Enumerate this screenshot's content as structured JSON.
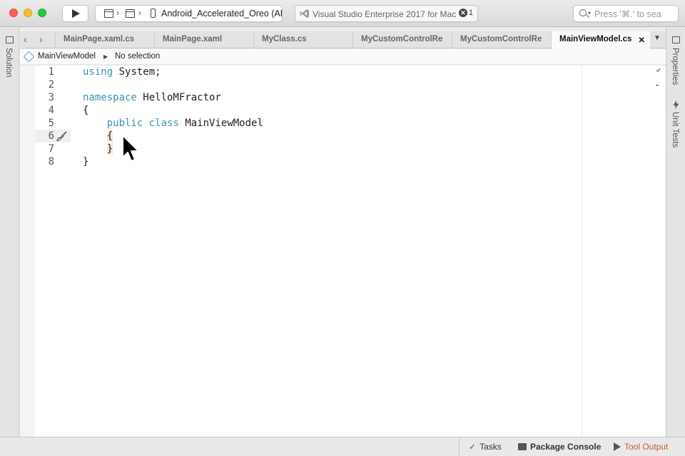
{
  "toolbar": {
    "device": "Android_Accelerated_Oreo (API",
    "status": "Visual Studio Enterprise 2017 for Mac",
    "error_count": "1",
    "search_placeholder": "Press '⌘.' to sea"
  },
  "left_pad": {
    "solution_label": "Solution"
  },
  "right_pad": {
    "properties_label": "Properties",
    "unit_tests_label": "Unit Tests"
  },
  "tabs": [
    {
      "label": "MainPage.xaml.cs"
    },
    {
      "label": "MainPage.xaml"
    },
    {
      "label": "MyClass.cs"
    },
    {
      "label": "MyCustomControlRe"
    },
    {
      "label": "MyCustomControlRe"
    },
    {
      "label": "MainViewModel.cs",
      "active": true
    }
  ],
  "breadcrumb": {
    "class_name": "MainViewModel",
    "member": "No selection"
  },
  "editor": {
    "current_line": 6,
    "lines": [
      {
        "num": "1",
        "kw": "using",
        "rest": " System;"
      },
      {
        "num": "2",
        "kw": "",
        "rest": ""
      },
      {
        "num": "3",
        "kw": "namespace",
        "rest": " HelloMFractor"
      },
      {
        "num": "4",
        "kw": "",
        "rest": "{"
      },
      {
        "num": "5",
        "kw": "",
        "rest": "    public class MainViewModel"
      },
      {
        "num": "6",
        "kw": "",
        "rest": "    {"
      },
      {
        "num": "7",
        "kw": "",
        "rest": "    }"
      },
      {
        "num": "8",
        "kw": "",
        "rest": "}"
      }
    ]
  },
  "bottom": {
    "tasks_label": "Tasks",
    "console_label": "Package Console",
    "output_label": "Tool Output"
  },
  "colors": {
    "keyword": "#3c94b0",
    "tool_output": "#c9583c",
    "brace_highlight": "#f7e6d8"
  }
}
